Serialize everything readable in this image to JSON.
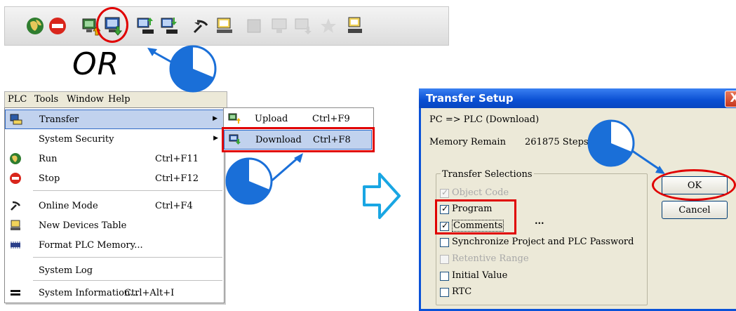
{
  "toolbar": {
    "icons": [
      "online-icon",
      "stop-icon",
      "upload-icon",
      "download-icon",
      "upload-memory-icon",
      "download-memory-icon",
      "online-mode-icon",
      "devices-table-icon",
      "disabled-icon-1",
      "disabled-icon-2",
      "disabled-icon-3",
      "disabled-icon-4",
      "network-icon"
    ]
  },
  "or_text": "OR",
  "menubar": {
    "items": [
      {
        "label": "PLC"
      },
      {
        "label": "Tools"
      },
      {
        "label": "Window"
      },
      {
        "label": "Help"
      }
    ]
  },
  "plc_menu": {
    "items": [
      {
        "label": "Transfer",
        "shortcut": ""
      },
      {
        "label": "System Security",
        "shortcut": ""
      },
      {
        "label": "Run",
        "shortcut": "Ctrl+F11"
      },
      {
        "label": "Stop",
        "shortcut": "Ctrl+F12"
      },
      {
        "label": "Online Mode",
        "shortcut": "Ctrl+F4"
      },
      {
        "label": "New Devices Table",
        "shortcut": ""
      },
      {
        "label": "Format PLC Memory...",
        "shortcut": ""
      },
      {
        "label": "System Log",
        "shortcut": ""
      },
      {
        "label": "System Information...",
        "shortcut": "Ctrl+Alt+I"
      }
    ]
  },
  "transfer_submenu": {
    "items": [
      {
        "label": "Upload",
        "shortcut": "Ctrl+F9"
      },
      {
        "label": "Download",
        "shortcut": "Ctrl+F8"
      }
    ]
  },
  "dialog": {
    "title": "Transfer Setup",
    "close": "X",
    "direction": "PC => PLC (Download)",
    "memory_label": "Memory Remain",
    "memory_value": "261875 Steps",
    "group_label": "Transfer Selections",
    "options": [
      {
        "label": "Object Code",
        "checked": true,
        "enabled": false
      },
      {
        "label": "Program",
        "checked": true,
        "enabled": true
      },
      {
        "label": "Comments",
        "checked": true,
        "enabled": true
      },
      {
        "label": "Synchronize Project and PLC Password",
        "checked": false,
        "enabled": true
      },
      {
        "label": "Retentive Range",
        "checked": false,
        "enabled": false
      },
      {
        "label": "Initial Value",
        "checked": false,
        "enabled": true
      },
      {
        "label": "RTC",
        "checked": false,
        "enabled": true
      }
    ],
    "ellipsis": "...",
    "ok_label": "OK",
    "cancel_label": "Cancel"
  },
  "colors": {
    "highlight": "#e00000",
    "titlebar": "#0a4fd3",
    "pointer": "#1a6fd8"
  }
}
